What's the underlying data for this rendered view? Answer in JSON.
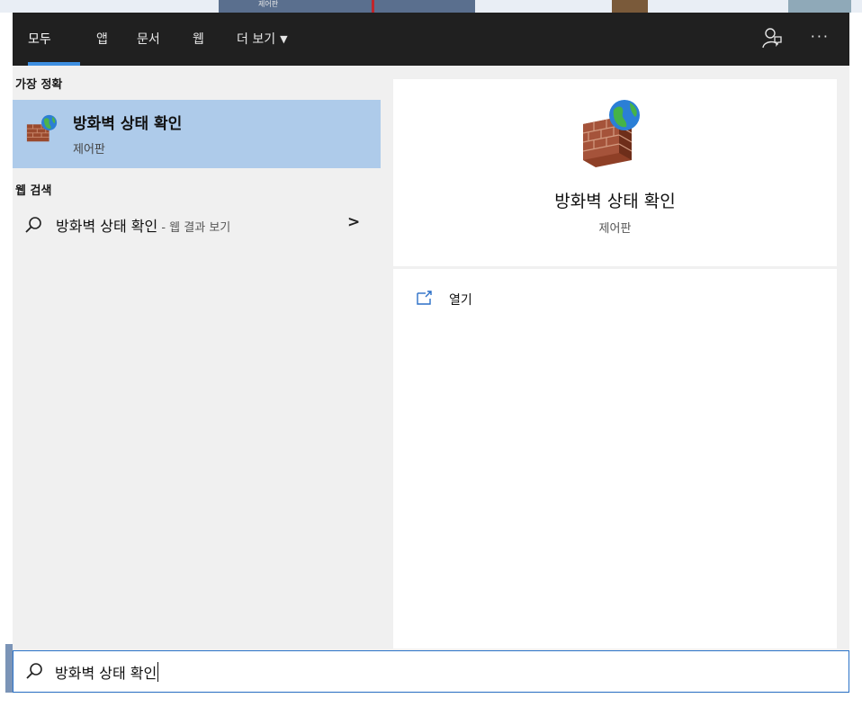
{
  "background": {
    "thumb_text": "제어판"
  },
  "tabs": [
    {
      "label": "모두",
      "active": true
    },
    {
      "label": "앱"
    },
    {
      "label": "문서"
    },
    {
      "label": "웹"
    },
    {
      "label": "더 보기",
      "dropdown": true
    }
  ],
  "toolbar": {
    "feedback_icon": "feedback-person-icon",
    "more_label": "···"
  },
  "best_match": {
    "header": "가장 정확",
    "title": "방화벽 상태 확인",
    "subtitle": "제어판",
    "icon": "firewall-globe-icon"
  },
  "web_search": {
    "header": "웹 검색",
    "query": "방화벽 상태 확인",
    "suffix": " - 웹 결과 보기",
    "chevron": ">"
  },
  "detail": {
    "title": "방화벽 상태 확인",
    "subtitle": "제어판",
    "open_label": "열기",
    "open_icon": "open-window-icon"
  },
  "search_box": {
    "value": "방화벽 상태 확인",
    "icon": "search-icon"
  },
  "colors": {
    "topbar_bg": "#202020",
    "accent": "#3d8ee0",
    "selected_bg": "#aecbea",
    "pane_bg": "#f0f0f0",
    "search_border": "#2b72c8"
  }
}
